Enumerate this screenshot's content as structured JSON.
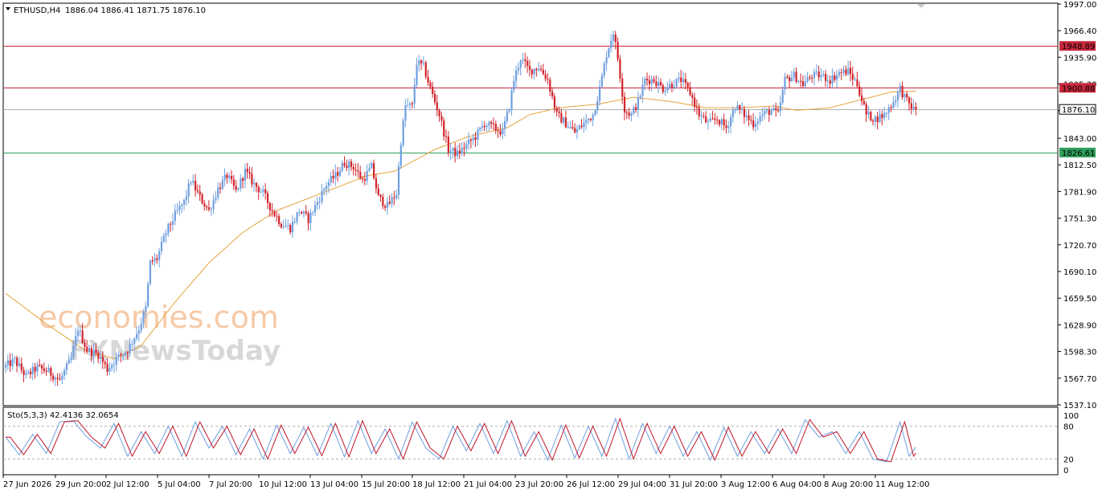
{
  "header": {
    "symbol": "ETHUSD,H4",
    "ohlc": "1886.04 1886.41 1871.75 1876.10"
  },
  "watermark": {
    "line1": "economies.com",
    "line2": "FXNewsToday"
  },
  "colors": {
    "bull": "#6f9fe0",
    "bear": "#d0242b",
    "ma": "#e6a33c",
    "resistance": "#c8283c",
    "support": "#2e9e5b",
    "current": "#b0b0b0",
    "stoch_main": "#6f9fe0",
    "stoch_signal": "#c0162a"
  },
  "chart_data": {
    "type": "candlestick",
    "price_axis": {
      "ticks": [
        "1997.00",
        "1966.40",
        "1935.90",
        "1905.30",
        "1874.80",
        "1843.00",
        "1812.50",
        "1781.90",
        "1751.30",
        "1720.70",
        "1690.10",
        "1659.50",
        "1628.90",
        "1598.30",
        "1567.70",
        "1537.10"
      ]
    },
    "time_axis": {
      "ticks": [
        "27 Jun 2026",
        "29 Jun 20:00",
        "2 Jul 12:00",
        "5 Jul 04:00",
        "7 Jul 20:00",
        "10 Jul 12:00",
        "13 Jul 04:00",
        "15 Jul 20:00",
        "18 Jul 12:00",
        "21 Jul 04:00",
        "23 Jul 20:00",
        "26 Jul 12:00",
        "29 Jul 04:00",
        "31 Jul 20:00",
        "3 Aug 12:00",
        "6 Aug 04:00",
        "8 Aug 20:00",
        "11 Aug 12:00"
      ]
    },
    "levels": [
      {
        "name": "resistance-2",
        "value": 1948.89,
        "label": "1948.89"
      },
      {
        "name": "resistance-1",
        "value": 1900.88,
        "label": "1900.88"
      },
      {
        "name": "current-price",
        "value": 1876.1,
        "label": "1876.10"
      },
      {
        "name": "support-1",
        "value": 1826.61,
        "label": "1826.61"
      }
    ],
    "price_key": [
      [
        0,
        1580
      ],
      [
        5,
        1588
      ],
      [
        10,
        1570
      ],
      [
        15,
        1580
      ],
      [
        20,
        1575
      ],
      [
        25,
        1565
      ],
      [
        30,
        1590
      ],
      [
        33,
        1625
      ],
      [
        37,
        1600
      ],
      [
        42,
        1595
      ],
      [
        46,
        1578
      ],
      [
        50,
        1590
      ],
      [
        55,
        1600
      ],
      [
        60,
        1625
      ],
      [
        63,
        1648
      ],
      [
        65,
        1700
      ],
      [
        68,
        1705
      ],
      [
        72,
        1735
      ],
      [
        76,
        1755
      ],
      [
        80,
        1770
      ],
      [
        83,
        1795
      ],
      [
        87,
        1775
      ],
      [
        91,
        1760
      ],
      [
        95,
        1785
      ],
      [
        99,
        1800
      ],
      [
        103,
        1782
      ],
      [
        107,
        1805
      ],
      [
        111,
        1790
      ],
      [
        115,
        1780
      ],
      [
        119,
        1760
      ],
      [
        123,
        1745
      ],
      [
        127,
        1740
      ],
      [
        131,
        1760
      ],
      [
        135,
        1750
      ],
      [
        139,
        1770
      ],
      [
        143,
        1790
      ],
      [
        147,
        1800
      ],
      [
        151,
        1815
      ],
      [
        155,
        1810
      ],
      [
        159,
        1795
      ],
      [
        163,
        1810
      ],
      [
        166,
        1775
      ],
      [
        170,
        1765
      ],
      [
        174,
        1780
      ],
      [
        176,
        1840
      ],
      [
        178,
        1880
      ],
      [
        181,
        1880
      ],
      [
        183,
        1930
      ],
      [
        186,
        1925
      ],
      [
        189,
        1900
      ],
      [
        193,
        1870
      ],
      [
        197,
        1830
      ],
      [
        201,
        1825
      ],
      [
        205,
        1835
      ],
      [
        209,
        1845
      ],
      [
        213,
        1860
      ],
      [
        217,
        1855
      ],
      [
        221,
        1850
      ],
      [
        224,
        1880
      ],
      [
        226,
        1910
      ],
      [
        229,
        1935
      ],
      [
        233,
        1920
      ],
      [
        237,
        1925
      ],
      [
        241,
        1910
      ],
      [
        245,
        1870
      ],
      [
        249,
        1860
      ],
      [
        253,
        1850
      ],
      [
        257,
        1860
      ],
      [
        261,
        1870
      ],
      [
        264,
        1900
      ],
      [
        267,
        1940
      ],
      [
        270,
        1965
      ],
      [
        272,
        1935
      ],
      [
        275,
        1875
      ],
      [
        278,
        1870
      ],
      [
        281,
        1885
      ],
      [
        284,
        1910
      ],
      [
        288,
        1910
      ],
      [
        292,
        1900
      ],
      [
        296,
        1905
      ],
      [
        300,
        1910
      ],
      [
        304,
        1895
      ],
      [
        308,
        1870
      ],
      [
        312,
        1860
      ],
      [
        316,
        1865
      ],
      [
        320,
        1855
      ],
      [
        324,
        1880
      ],
      [
        328,
        1870
      ],
      [
        332,
        1860
      ],
      [
        336,
        1870
      ],
      [
        340,
        1875
      ],
      [
        343,
        1870
      ],
      [
        346,
        1910
      ],
      [
        350,
        1915
      ],
      [
        354,
        1905
      ],
      [
        358,
        1915
      ],
      [
        362,
        1915
      ],
      [
        366,
        1910
      ],
      [
        370,
        1918
      ],
      [
        374,
        1920
      ],
      [
        378,
        1905
      ],
      [
        382,
        1870
      ],
      [
        386,
        1865
      ],
      [
        390,
        1870
      ],
      [
        394,
        1885
      ],
      [
        397,
        1900
      ],
      [
        400,
        1885
      ],
      [
        403,
        1876
      ]
    ],
    "ma_key": [
      [
        0,
        1665
      ],
      [
        18,
        1630
      ],
      [
        35,
        1600
      ],
      [
        48,
        1590
      ],
      [
        60,
        1605
      ],
      [
        75,
        1655
      ],
      [
        90,
        1700
      ],
      [
        105,
        1735
      ],
      [
        120,
        1760
      ],
      [
        135,
        1775
      ],
      [
        150,
        1790
      ],
      [
        160,
        1800
      ],
      [
        172,
        1805
      ],
      [
        190,
        1830
      ],
      [
        205,
        1845
      ],
      [
        222,
        1855
      ],
      [
        232,
        1870
      ],
      [
        245,
        1878
      ],
      [
        262,
        1882
      ],
      [
        278,
        1890
      ],
      [
        295,
        1885
      ],
      [
        310,
        1878
      ],
      [
        325,
        1878
      ],
      [
        340,
        1880
      ],
      [
        350,
        1875
      ],
      [
        365,
        1878
      ],
      [
        380,
        1888
      ],
      [
        392,
        1896
      ],
      [
        403,
        1897
      ]
    ],
    "stoch_axis": {
      "ticks": [
        "100",
        "80",
        "20",
        "0"
      ]
    },
    "stoch_label": "Sto(5,3,3) 42.4136 32.0654",
    "stoch_levels": [
      80,
      20
    ],
    "stoch_key": [
      [
        0,
        60
      ],
      [
        6,
        28
      ],
      [
        12,
        65
      ],
      [
        18,
        30
      ],
      [
        24,
        88
      ],
      [
        30,
        90
      ],
      [
        36,
        60
      ],
      [
        42,
        40
      ],
      [
        48,
        85
      ],
      [
        54,
        25
      ],
      [
        60,
        70
      ],
      [
        66,
        30
      ],
      [
        72,
        80
      ],
      [
        78,
        25
      ],
      [
        84,
        88
      ],
      [
        90,
        40
      ],
      [
        96,
        80
      ],
      [
        102,
        28
      ],
      [
        108,
        75
      ],
      [
        114,
        20
      ],
      [
        120,
        82
      ],
      [
        126,
        30
      ],
      [
        132,
        78
      ],
      [
        138,
        26
      ],
      [
        144,
        85
      ],
      [
        150,
        24
      ],
      [
        156,
        90
      ],
      [
        162,
        30
      ],
      [
        168,
        75
      ],
      [
        174,
        20
      ],
      [
        180,
        88
      ],
      [
        186,
        40
      ],
      [
        192,
        20
      ],
      [
        198,
        80
      ],
      [
        204,
        35
      ],
      [
        210,
        85
      ],
      [
        216,
        30
      ],
      [
        222,
        90
      ],
      [
        228,
        25
      ],
      [
        234,
        70
      ],
      [
        240,
        18
      ],
      [
        246,
        82
      ],
      [
        252,
        22
      ],
      [
        258,
        80
      ],
      [
        264,
        25
      ],
      [
        270,
        94
      ],
      [
        276,
        20
      ],
      [
        282,
        85
      ],
      [
        288,
        30
      ],
      [
        294,
        80
      ],
      [
        300,
        25
      ],
      [
        306,
        70
      ],
      [
        312,
        18
      ],
      [
        318,
        78
      ],
      [
        324,
        25
      ],
      [
        330,
        70
      ],
      [
        336,
        30
      ],
      [
        342,
        75
      ],
      [
        348,
        30
      ],
      [
        354,
        92
      ],
      [
        360,
        60
      ],
      [
        366,
        70
      ],
      [
        372,
        30
      ],
      [
        378,
        70
      ],
      [
        384,
        20
      ],
      [
        390,
        15
      ],
      [
        396,
        88
      ],
      [
        400,
        25
      ],
      [
        403,
        42
      ]
    ]
  }
}
